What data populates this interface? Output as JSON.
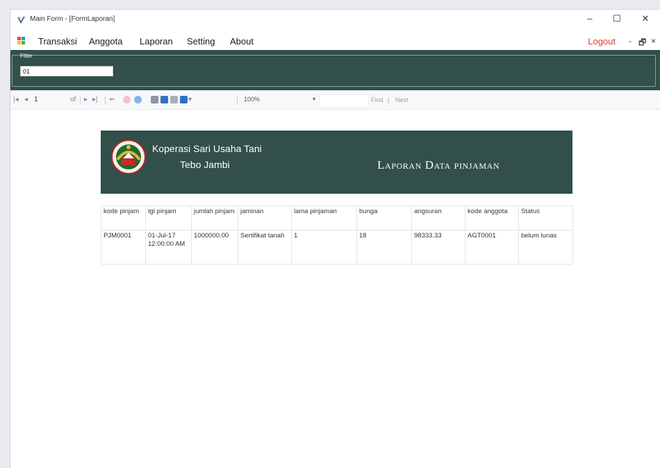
{
  "window": {
    "title": "Main Form - [FormLaporan]",
    "controls": [
      "–",
      "☐",
      "✕"
    ]
  },
  "menu": {
    "items": [
      "Transaksi",
      "Anggota",
      "Laporan",
      "Setting",
      "About"
    ],
    "logout": "Logout",
    "mdi_controls": [
      "-",
      "🗗",
      "×"
    ]
  },
  "filter": {
    "label": "Filter",
    "value": "01"
  },
  "toolbar": {
    "page_current": "1",
    "page_of": "of",
    "zoom": "100%",
    "find": "Find",
    "find_separator": "|",
    "next": "Next"
  },
  "report": {
    "org_name": "Koperasi Sari Usaha Tani",
    "org_location": "Tebo Jambi",
    "title": "Laporan Data pinjaman",
    "columns": [
      "kode pinjam",
      "tgl pinjam",
      "jumlah pinjam",
      "jaminan",
      "lama pinjaman",
      "bunga",
      "angsuran",
      "kode anggota",
      "Status"
    ],
    "rows": [
      {
        "kode_pinjam": "PJM0001",
        "tgl_pinjam": "01-Jul-17 12:00:00 AM",
        "jumlah_pinjam": "1000000.00",
        "jaminan": "Sertifikat tanah",
        "lama_pinjaman": "1",
        "bunga": "18",
        "angsuran": "98333.33",
        "kode_anggota": "AGT0001",
        "status": "belum lunas"
      }
    ]
  },
  "colors": {
    "header_bg": "#324f4a",
    "logout": "#d9423a"
  }
}
